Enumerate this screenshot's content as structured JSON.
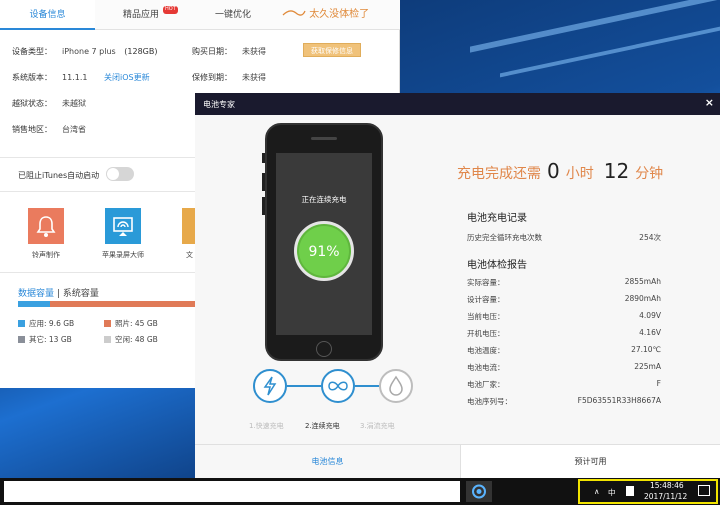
{
  "main_window": {
    "tabs": [
      {
        "label": "设备信息"
      },
      {
        "label": "精品应用"
      },
      {
        "label": "一键优化"
      }
    ],
    "hot_badge": "HOT",
    "promo_text": "太久没体检了",
    "device_info": {
      "type_label": "设备类型：",
      "type_value": "iPhone 7 plus",
      "capacity": "(128GB)",
      "sys_label": "系统版本：",
      "sys_value": "11.1.1",
      "sys_link": "关闭iOS更新",
      "jb_label": "越狱状态：",
      "jb_value": "未越狱",
      "region_label": "销售地区：",
      "region_value": "台湾省",
      "buy_label": "购买日期：",
      "buy_value": "未获得",
      "warranty_label": "保修到期：",
      "warranty_value": "未获得",
      "warranty_button": "获取保修信息"
    },
    "itunes_toggle_label": "已阻止iTunes自动启动",
    "tools": [
      {
        "label": "铃声制作"
      },
      {
        "label": "苹果录屏大师"
      },
      {
        "label": "文"
      }
    ],
    "capacity_tabs": {
      "data": "数据容量",
      "divider": "|",
      "system": "系统容量"
    },
    "capacity_legend": [
      {
        "label": "应用: 9.6 GB",
        "color": "#3aa0e0"
      },
      {
        "label": "照片: 45 GB",
        "color": "#e07a57"
      },
      {
        "label": "其它: 13 GB",
        "color": "#8a8f99"
      },
      {
        "label": "空闲: 48 GB",
        "color": "#cccccc"
      }
    ],
    "capacity_bar": [
      {
        "fraction": 0.083,
        "color": "#3aa0e0"
      },
      {
        "fraction": 0.391,
        "color": "#e07a57"
      },
      {
        "fraction": 0.113,
        "color": "#8a8f99"
      },
      {
        "fraction": 0.413,
        "color": "#dddddd"
      }
    ]
  },
  "battery_window": {
    "title": "电池专家",
    "close": "×",
    "phone_status": "正在连续充电",
    "battery_percent": "91%",
    "remain_prefix": "充电完成还需",
    "remain_hours": "0",
    "hours_unit": "小时",
    "remain_minutes": "12",
    "minutes_unit": "分钟",
    "charge_record_title": "电池充电记录",
    "charge_record": [
      {
        "k": "历史完全循环充电次数",
        "v": "254次"
      }
    ],
    "health_title": "电池体检报告",
    "health": [
      {
        "k": "实际容量：",
        "v": "2855mAh"
      },
      {
        "k": "设计容量：",
        "v": "2890mAh"
      },
      {
        "k": "当前电压：",
        "v": "4.09V"
      },
      {
        "k": "开机电压：",
        "v": "4.16V"
      },
      {
        "k": "电池温度：",
        "v": "27.10℃"
      },
      {
        "k": "电池电流：",
        "v": "225mA"
      },
      {
        "k": "电池厂家：",
        "v": "F"
      },
      {
        "k": "电池序列号：",
        "v": "F5D63551R33H8667A"
      }
    ],
    "steps": [
      {
        "label": "1.快速充电",
        "icon": "lightning-icon"
      },
      {
        "label": "2.连续充电",
        "icon": "infinity-icon"
      },
      {
        "label": "3.涓流充电",
        "icon": "drop-icon"
      }
    ],
    "bottom_tabs": {
      "left": "电池信息",
      "right": "预计可用"
    }
  },
  "taskbar": {
    "ime": "中",
    "time": "15:48:46",
    "date": "2017/11/12"
  }
}
